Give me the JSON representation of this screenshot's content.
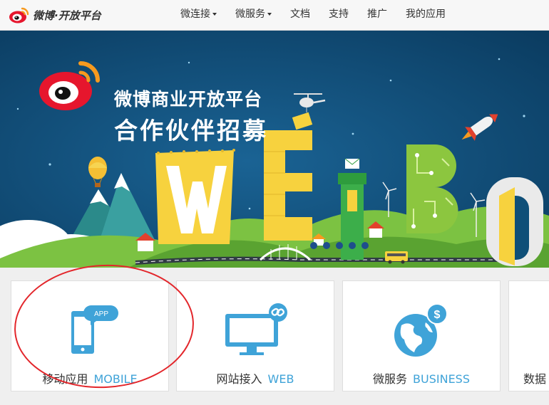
{
  "header": {
    "logo_text": "微博·开放平台",
    "nav": [
      {
        "label": "微连接",
        "has_caret": true
      },
      {
        "label": "微服务",
        "has_caret": true
      },
      {
        "label": "文档",
        "has_caret": false
      },
      {
        "label": "支持",
        "has_caret": false
      },
      {
        "label": "推广",
        "has_caret": false
      },
      {
        "label": "我的应用",
        "has_caret": false
      }
    ]
  },
  "banner": {
    "title_line1": "微博商业开放平台",
    "title_line2": "合作伙伴招募",
    "icons": [
      "weibo-logo-icon",
      "helicopter-icon",
      "rocket-icon",
      "hot-air-balloon-icon",
      "mail-icon",
      "wind-turbine-icon",
      "bus-icon",
      "house-icon",
      "door-icon"
    ],
    "colors": {
      "sky": "#0d4a72",
      "grass": "#7cc242",
      "letters_yellow": "#f7d23e"
    }
  },
  "cards": [
    {
      "label": "移动应用",
      "label_en": "MOBILE",
      "icon": "mobile-app-icon",
      "badge": "APP"
    },
    {
      "label": "网站接入",
      "label_en": "WEB",
      "icon": "monitor-link-icon",
      "badge": ""
    },
    {
      "label": "微服务",
      "label_en": "BUSINESS",
      "icon": "globe-dollar-icon",
      "badge": ""
    },
    {
      "label": "数据",
      "label_en": "",
      "icon": "",
      "badge": ""
    }
  ],
  "colors": {
    "accent_blue": "#3fa3d8",
    "annotation_red": "#e3262b"
  }
}
